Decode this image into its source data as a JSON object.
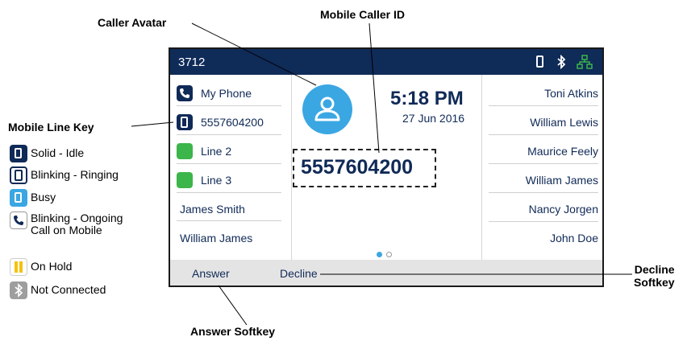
{
  "callouts": {
    "caller_avatar": "Caller Avatar",
    "mobile_caller_id": "Mobile Caller ID",
    "mobile_line_key": "Mobile Line Key",
    "decline_softkey_line1": "Decline",
    "decline_softkey_line2": "Softkey",
    "answer_softkey": "Answer Softkey"
  },
  "legend": [
    {
      "label": "Solid - Idle",
      "icon": "mobile-solid-icon",
      "color": "#102a57"
    },
    {
      "label": "Blinking - Ringing",
      "icon": "mobile-outline-icon",
      "color": "#102a57"
    },
    {
      "label": "Busy",
      "icon": "mobile-busy-icon",
      "color": "#3aa7e3"
    },
    {
      "label": "Blinking - Ongoing",
      "label2": "Call on Mobile",
      "icon": "handset-icon",
      "color": "#102a57"
    },
    {
      "label": "On Hold",
      "icon": "pause-icon",
      "color": "#f4c20d"
    },
    {
      "label": "Not Connected",
      "icon": "bluetooth-icon",
      "color": "#9e9e9e"
    }
  ],
  "phone": {
    "extension": "3712",
    "status_icons": [
      "mobile-icon",
      "bluetooth-icon",
      "network-icon"
    ],
    "line_keys": [
      {
        "label": "My Phone",
        "icon": "handset-icon"
      },
      {
        "label": "5557604200",
        "icon": "mobile-icon"
      },
      {
        "label": "Line 2",
        "icon": "green-square",
        "color": "#3cb54a"
      },
      {
        "label": "Line 3",
        "icon": "green-square",
        "color": "#3cb54a"
      },
      {
        "label": "James Smith"
      },
      {
        "label": "William James"
      }
    ],
    "contacts": [
      "Toni Atkins",
      "William Lewis",
      "Maurice Feely",
      "William James",
      "Nancy Jorgen",
      "John Doe"
    ],
    "time": "5:18 PM",
    "date": "27 Jun 2016",
    "caller_id": "5557604200",
    "softkeys": {
      "answer": "Answer",
      "decline": "Decline"
    },
    "page_dots": 2
  },
  "colors": {
    "topbar": "#0f2b58",
    "accent": "#3aa7e3",
    "text": "#102a57",
    "softbar": "#e4e4e4"
  }
}
